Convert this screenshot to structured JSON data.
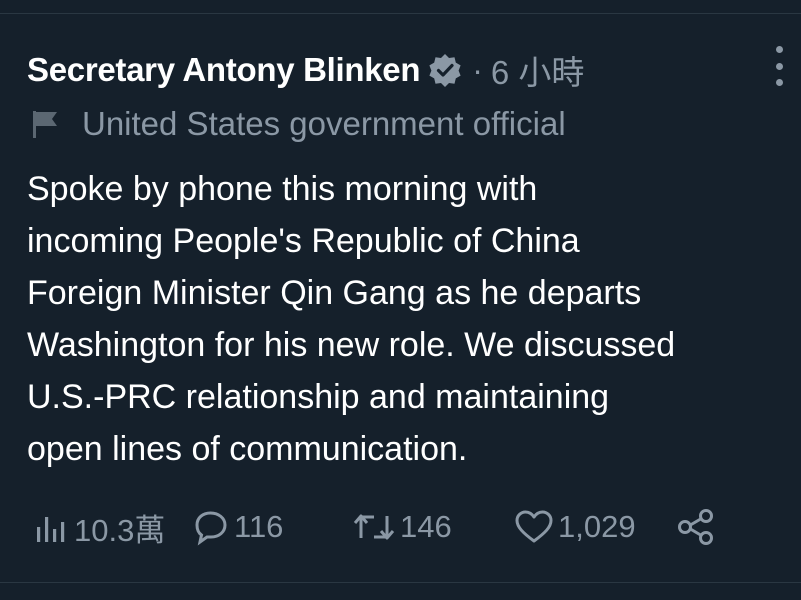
{
  "tweet": {
    "author_name": "Secretary Antony Blinken",
    "separator": "·",
    "timestamp": "6 小時",
    "label": "United States government official",
    "body_lines": [
      "Spoke by phone this morning with",
      "incoming People's Republic of China",
      "Foreign Minister Qin Gang as he departs",
      "Washington for his new role. We discussed",
      "U.S.-PRC relationship and maintaining",
      "open lines of communication."
    ],
    "views": "10.3萬",
    "replies": "116",
    "retweets": "146",
    "likes": "1,029"
  },
  "icons": {
    "verified": "verified-badge-icon",
    "more": "more-vertical-icon",
    "label": "flag-icon",
    "views": "bar-chart-icon",
    "reply": "speech-bubble-icon",
    "retweet": "retweet-icon",
    "like": "heart-icon",
    "share": "share-icon"
  },
  "colors": {
    "background": "#15202b",
    "text_primary": "#ffffff",
    "text_secondary": "#8b98a5"
  }
}
